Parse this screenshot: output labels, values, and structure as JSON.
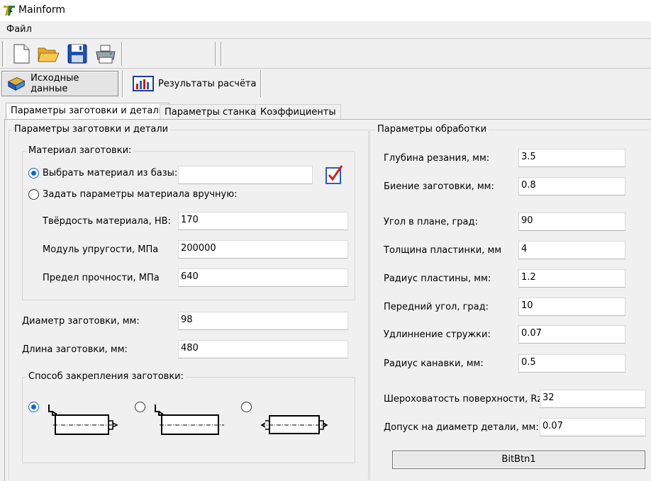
{
  "window": {
    "title": "Mainform",
    "icon": "app-logo-icon"
  },
  "menu": {
    "items": [
      {
        "label": "Файл"
      }
    ]
  },
  "toolbar": {
    "icons": [
      "new-file-icon",
      "open-folder-icon",
      "save-disk-icon",
      "print-icon"
    ]
  },
  "nav": {
    "input_label": "Исходные данные",
    "results_label": "Результаты расчёта"
  },
  "tabs": [
    {
      "label": "Параметры заготовки и детали",
      "active": true
    },
    {
      "label": "Параметры станка",
      "active": false
    },
    {
      "label": "Коэффициенты",
      "active": false
    }
  ],
  "left_group": {
    "title": "Параметры заготовки и детали",
    "material": {
      "title": "Материал заготовки:",
      "from_db_label": "Выбрать материал из базы:",
      "from_db_value": "",
      "manual_label": "Задать параметры материала вручную:",
      "selected": "from_db",
      "fields": [
        {
          "label": "Твёрдость материала, НВ:",
          "value": "170"
        },
        {
          "label": "Модуль упругости, МПа",
          "value": "200000"
        },
        {
          "label": "Предел прочности, МПа",
          "value": "640"
        }
      ]
    },
    "dims": [
      {
        "label": "Диаметр заготовки, мм:",
        "value": "98"
      },
      {
        "label": "Длина заготовки, мм:",
        "value": "480"
      }
    ],
    "clamping": {
      "title": "Способ закрепления заготовки:",
      "selected": 0
    }
  },
  "right_group": {
    "title": "Параметры обработки",
    "fields": [
      {
        "label": "Глубина резания, мм:",
        "value": "3.5"
      },
      {
        "label": "Биение заготовки, мм:",
        "value": "0.8"
      },
      {
        "label": "Угол в плане, град:",
        "value": "90"
      },
      {
        "label": "Толщина пластинки, мм",
        "value": "4"
      },
      {
        "label": "Радиус пластины, мм:",
        "value": "1.2"
      },
      {
        "label": "Передний угол, град:",
        "value": "10"
      },
      {
        "label": "Удлиннение стружки:",
        "value": "0.07"
      },
      {
        "label": "Радиус канавки, мм:",
        "value": "0.5"
      }
    ],
    "extra_fields": [
      {
        "label": "Шероховатость поверхности, Rz:",
        "value": "32"
      },
      {
        "label": "Допуск на диаметр детали, мм:",
        "value": "0.07"
      }
    ],
    "button_label": "BitBtn1"
  }
}
